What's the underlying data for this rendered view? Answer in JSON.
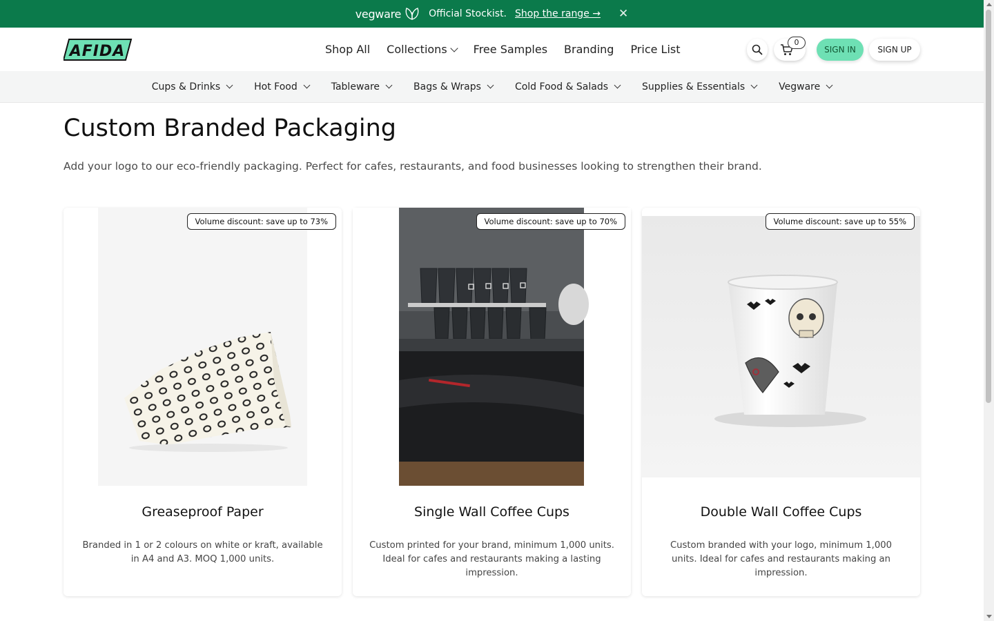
{
  "announcement": {
    "brand": "vegware",
    "stockist": "Official Stockist.",
    "link": "Shop the range →"
  },
  "header": {
    "logo": "AFIDA",
    "nav": [
      "Shop All",
      "Collections",
      "Free Samples",
      "Branding",
      "Price List"
    ],
    "cart_count": "0",
    "sign_in": "SIGN IN",
    "sign_up": "SIGN UP"
  },
  "categories": [
    "Cups & Drinks",
    "Hot Food",
    "Tableware",
    "Bags & Wraps",
    "Cold Food & Salads",
    "Supplies & Essentials",
    "Vegware"
  ],
  "page": {
    "title": "Custom Branded Packaging",
    "subtitle": "Add your logo to our eco-friendly packaging. Perfect for cafes, restaurants, and food businesses looking to strengthen their brand."
  },
  "products": [
    {
      "badge": "Volume discount: save up to 73%",
      "title": "Greaseproof Paper",
      "description": "Branded in 1 or 2 colours on white or kraft, available in A4 and A3. MOQ 1,000 units."
    },
    {
      "badge": "Volume discount: save up to 70%",
      "title": "Single Wall Coffee Cups",
      "description": "Custom printed for your brand, minimum 1,000 units. Ideal for cafes and restaurants making a lasting impression."
    },
    {
      "badge": "Volume discount: save up to 55%",
      "title": "Double Wall Coffee Cups",
      "description": "Custom branded with your logo, minimum 1,000 units. Ideal for cafes and restaurants making an impression."
    }
  ]
}
